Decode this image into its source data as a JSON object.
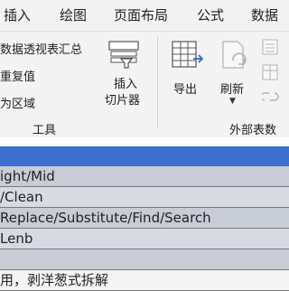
{
  "menu": {
    "tabs": [
      "插入",
      "绘图",
      "页面布局",
      "公式",
      "数据"
    ]
  },
  "ribbon": {
    "tools_group": {
      "items": [
        "数据透视表汇总",
        "重复值",
        "为区域"
      ],
      "label": "工具"
    },
    "slicer": {
      "line1": "插入",
      "line2": "切片器"
    },
    "external_group": {
      "export_label": "导出",
      "refresh_label": "刷新",
      "label": "外部表数"
    }
  },
  "sheet": {
    "rows": [
      "ight/Mid",
      "/Clean",
      "Replace/Substitute/Find/Search",
      "Lenb",
      "",
      "用，剥洋葱式拆解"
    ]
  },
  "colors": {
    "header_band": "#3f6fd1",
    "row_fill": "#c8ccd6"
  }
}
